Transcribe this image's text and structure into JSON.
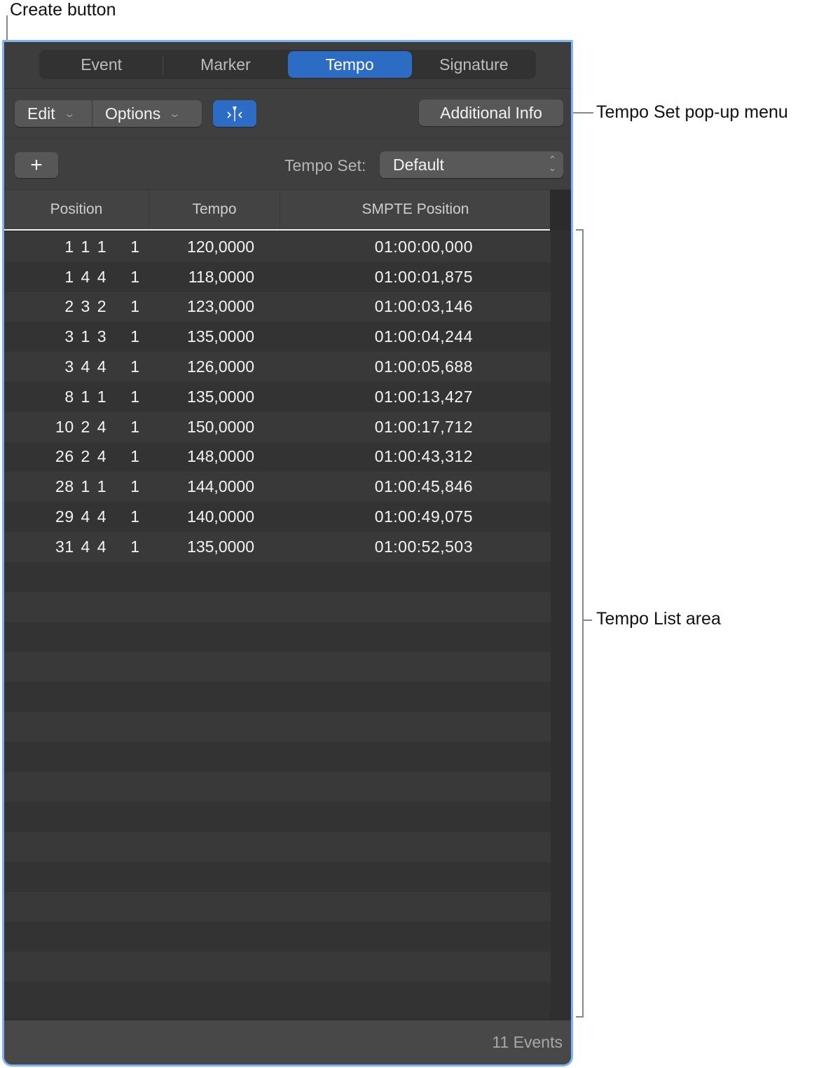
{
  "callouts": {
    "create_button": "Create button",
    "tempo_set_menu": "Tempo Set pop-up menu",
    "tempo_list_area": "Tempo List area"
  },
  "tabs": [
    {
      "label": "Event",
      "active": false
    },
    {
      "label": "Marker",
      "active": false
    },
    {
      "label": "Tempo",
      "active": true
    },
    {
      "label": "Signature",
      "active": false
    }
  ],
  "toolbar": {
    "edit_label": "Edit",
    "options_label": "Options",
    "catch_icon": "catch-playhead-icon",
    "additional_info_label": "Additional Info"
  },
  "create_row": {
    "plus_glyph": "+",
    "tempo_set_label": "Tempo Set:",
    "tempo_set_value": "Default"
  },
  "table": {
    "columns": [
      "Position",
      "Tempo",
      "SMPTE Position"
    ],
    "rows": [
      {
        "position": "1 1 1",
        "unit": "1",
        "tempo": "120,0000",
        "smpte": "01:00:00,000"
      },
      {
        "position": "1 4 4",
        "unit": "1",
        "tempo": "118,0000",
        "smpte": "01:00:01,875"
      },
      {
        "position": "2 3 2",
        "unit": "1",
        "tempo": "123,0000",
        "smpte": "01:00:03,146"
      },
      {
        "position": "3 1 3",
        "unit": "1",
        "tempo": "135,0000",
        "smpte": "01:00:04,244"
      },
      {
        "position": "3 4 4",
        "unit": "1",
        "tempo": "126,0000",
        "smpte": "01:00:05,688"
      },
      {
        "position": "8 1 1",
        "unit": "1",
        "tempo": "135,0000",
        "smpte": "01:00:13,427"
      },
      {
        "position": "10 2 4",
        "unit": "1",
        "tempo": "150,0000",
        "smpte": "01:00:17,712"
      },
      {
        "position": "26 2 4",
        "unit": "1",
        "tempo": "148,0000",
        "smpte": "01:00:43,312"
      },
      {
        "position": "28 1 1",
        "unit": "1",
        "tempo": "144,0000",
        "smpte": "01:00:45,846"
      },
      {
        "position": "29 4 4",
        "unit": "1",
        "tempo": "140,0000",
        "smpte": "01:00:49,075"
      },
      {
        "position": "31 4 4",
        "unit": "1",
        "tempo": "135,0000",
        "smpte": "01:00:52,503"
      }
    ],
    "empty_rows": 15
  },
  "footer": {
    "events_count": "11 Events"
  },
  "colors": {
    "accent": "#2c6cc4",
    "window_border": "#7db4f5",
    "background": "#3f3f3f"
  }
}
